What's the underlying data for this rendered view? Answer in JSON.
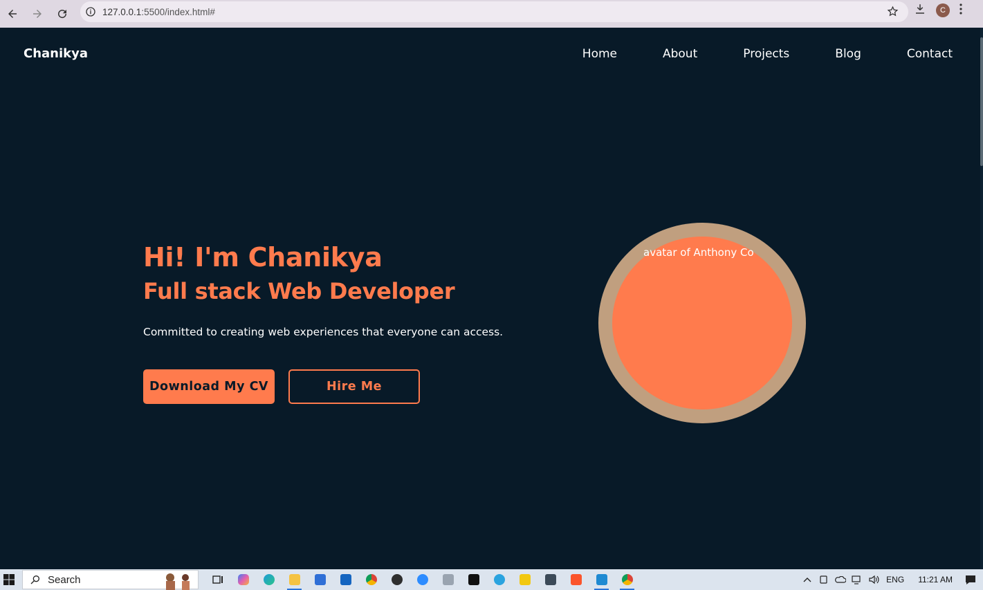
{
  "browser": {
    "url_host": "127.0.0.1",
    "url_rest": ":5500/index.html#",
    "profile_initial": "C"
  },
  "site": {
    "logo": "Chanikya",
    "nav": [
      "Home",
      "About",
      "Projects",
      "Blog",
      "Contact"
    ]
  },
  "hero": {
    "greeting": "Hi! I'm Chanikya",
    "role": "Full stack Web Developer",
    "tagline": "Committed to creating web experiences that everyone can access.",
    "cv_button": "Download My CV",
    "hire_button": "Hire Me",
    "avatar_alt": "avatar of Anthony Co"
  },
  "taskbar": {
    "search_label": "Search",
    "language": "ENG",
    "time": "11:21 AM"
  },
  "colors": {
    "background": "#081a28",
    "accent": "#ff7b4d",
    "ring": "#c09f7f"
  }
}
